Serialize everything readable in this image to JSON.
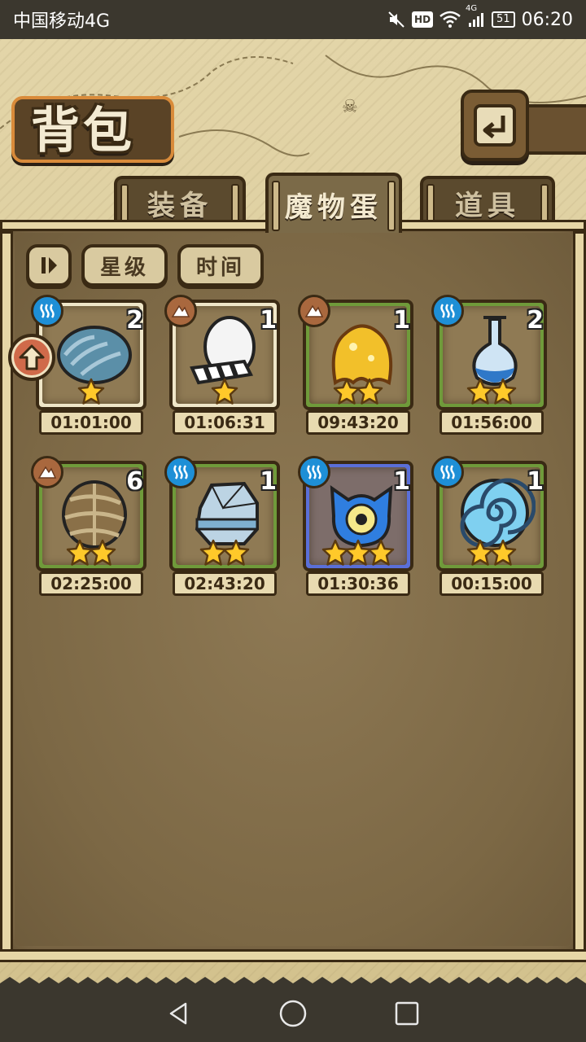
{
  "status_bar": {
    "carrier": "中国移动4G",
    "network_badge": "HD",
    "signal_label": "4G",
    "battery": "51",
    "time": "06:20"
  },
  "header": {
    "title": "背包",
    "back_icon": "return-icon"
  },
  "tabs": [
    {
      "label": "装备",
      "active": false
    },
    {
      "label": "魔物蛋",
      "active": true
    },
    {
      "label": "道具",
      "active": false
    }
  ],
  "filters": {
    "toggle_icon": "sort-toggle-icon",
    "star_label": "星级",
    "time_label": "时间"
  },
  "eggs": [
    {
      "element": "water",
      "count": "2",
      "stars": 1,
      "timer": "01:01:00",
      "frame": "white",
      "egg": "shell-blue"
    },
    {
      "element": "earth",
      "count": "1",
      "stars": 1,
      "timer": "01:06:31",
      "frame": "white",
      "egg": "white-egg"
    },
    {
      "element": "earth",
      "count": "1",
      "stars": 2,
      "timer": "09:43:20",
      "frame": "green",
      "egg": "gold-slime"
    },
    {
      "element": "water",
      "count": "2",
      "stars": 2,
      "timer": "01:56:00",
      "frame": "green",
      "egg": "blue-flask"
    },
    {
      "element": "earth",
      "count": "6",
      "stars": 2,
      "timer": "02:25:00",
      "frame": "green",
      "egg": "wrapped-egg"
    },
    {
      "element": "water",
      "count": "1",
      "stars": 2,
      "timer": "02:43:20",
      "frame": "green",
      "egg": "ice-rock"
    },
    {
      "element": "water",
      "count": "1",
      "stars": 3,
      "timer": "01:30:36",
      "frame": "blue",
      "egg": "blue-eye"
    },
    {
      "element": "water",
      "count": "1",
      "stars": 2,
      "timer": "00:15:00",
      "frame": "green",
      "egg": "spiral-shell"
    }
  ],
  "colors": {
    "water": "#1e8fd6",
    "earth": "#a9683e",
    "frame_white": "#efe6c8",
    "frame_green": "#6f9a3a",
    "frame_blue": "#5a6fd8"
  }
}
